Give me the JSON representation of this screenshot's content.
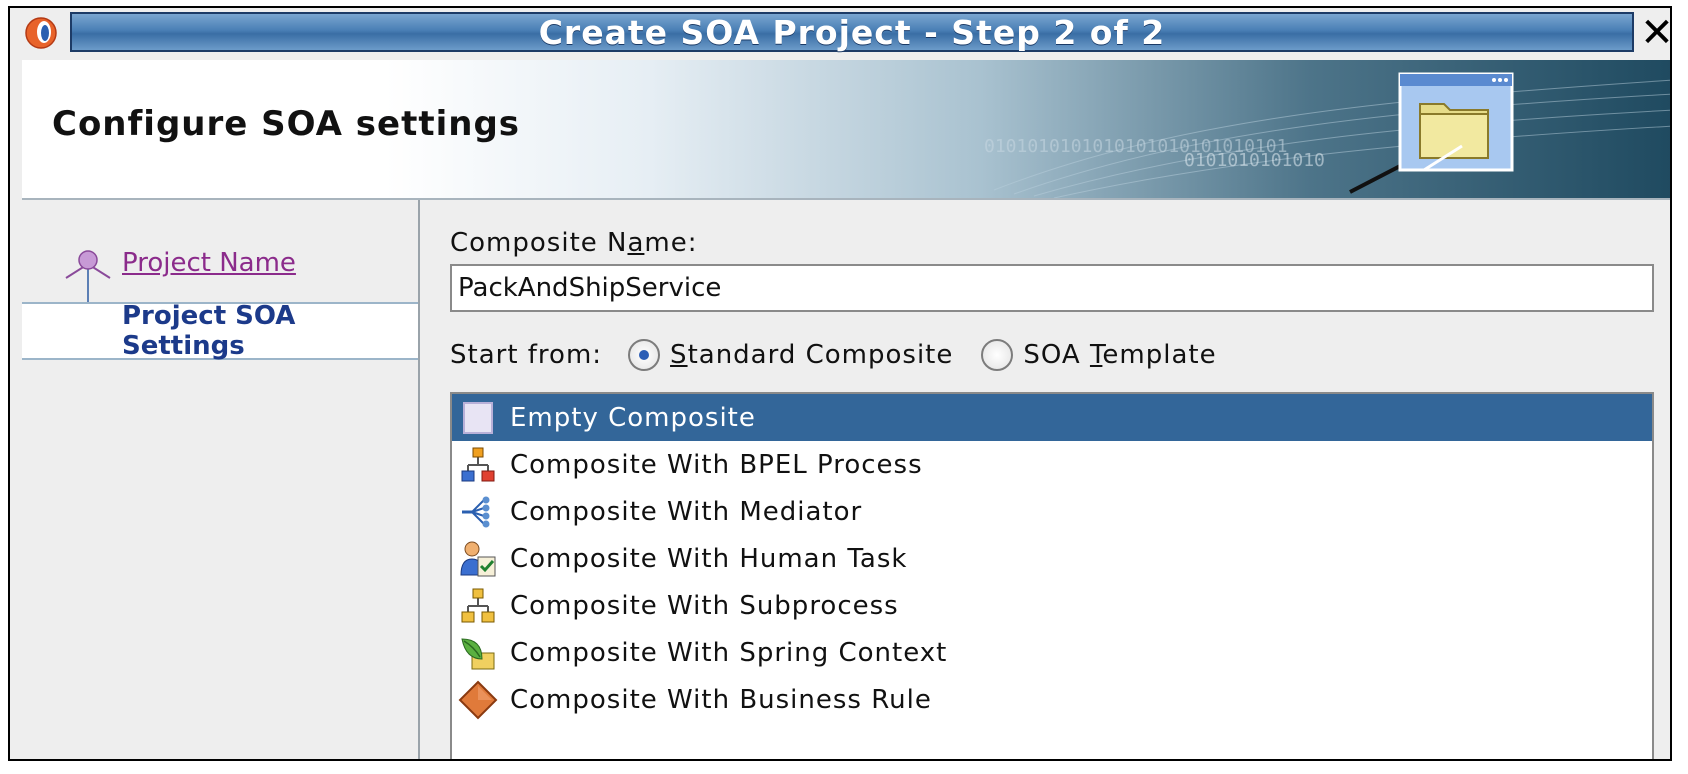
{
  "window": {
    "title": "Create SOA Project - Step 2 of 2",
    "close_glyph": "✕",
    "app_icon": "oracle-logo-icon"
  },
  "banner": {
    "title": "Configure SOA settings",
    "decoration_text_1": "0101010101010101010101010101",
    "decoration_text_2": "0101010101010",
    "icon": "folder-window-icon"
  },
  "nav": {
    "items": [
      {
        "label": "Project Name",
        "state": "visited"
      },
      {
        "label": "Project SOA Settings",
        "state": "current"
      }
    ]
  },
  "form": {
    "composite_name_label": "Composite Name:",
    "composite_name_label_parts": [
      "Composite N",
      "a",
      "me:"
    ],
    "composite_name_value": "PackAndShipService",
    "start_from_label": "Start from:",
    "options": [
      {
        "label_parts": [
          "",
          "S",
          "tandard Composite"
        ],
        "label": "Standard Composite",
        "checked": true
      },
      {
        "label_parts": [
          "SOA ",
          "T",
          "emplate"
        ],
        "label": "SOA Template",
        "checked": false
      }
    ]
  },
  "templates": {
    "items": [
      {
        "label": "Empty Composite",
        "icon": "empty-composite-icon",
        "selected": true
      },
      {
        "label": "Composite With BPEL Process",
        "icon": "bpel-process-icon",
        "selected": false
      },
      {
        "label": "Composite With Mediator",
        "icon": "mediator-icon",
        "selected": false
      },
      {
        "label": "Composite With Human Task",
        "icon": "human-task-icon",
        "selected": false
      },
      {
        "label": "Composite With Subprocess",
        "icon": "subprocess-icon",
        "selected": false
      },
      {
        "label": "Composite With Spring Context",
        "icon": "spring-context-icon",
        "selected": false
      },
      {
        "label": "Composite With Business Rule",
        "icon": "business-rule-icon",
        "selected": false
      }
    ]
  },
  "colors": {
    "title_bar": "#3a6ea5",
    "selection": "#336699",
    "nav_link": "#8b2b8b",
    "nav_current": "#1c3a8a"
  }
}
